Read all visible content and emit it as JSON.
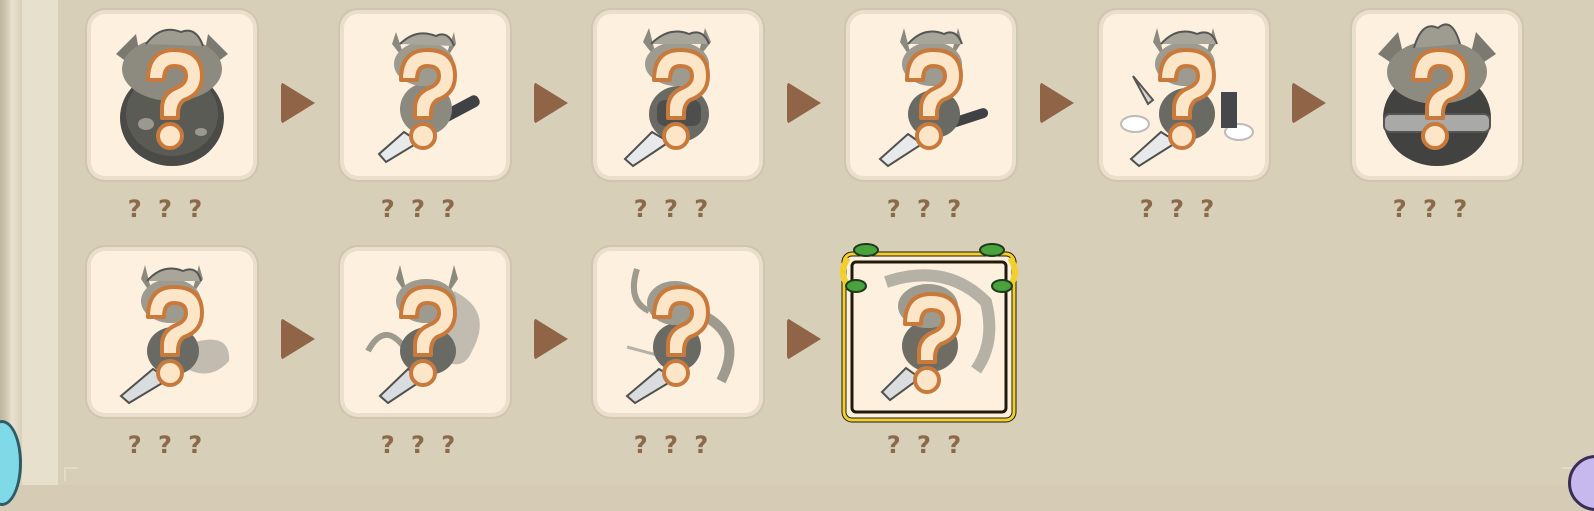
{
  "collection": {
    "row1": [
      {
        "label": "? ? ?",
        "icon": "egg-silhouette-icon"
      },
      {
        "label": "? ? ?",
        "icon": "cat-knight-sword-icon"
      },
      {
        "label": "? ? ?",
        "icon": "cat-knight-armored-icon"
      },
      {
        "label": "? ? ?",
        "icon": "cat-knight-leaping-icon"
      },
      {
        "label": "? ? ?",
        "icon": "cat-knight-clouds-icon"
      },
      {
        "label": "? ? ?",
        "icon": "egg-armored-silhouette-icon"
      }
    ],
    "row2": [
      {
        "label": "? ? ?",
        "icon": "cat-knight-smoke-icon"
      },
      {
        "label": "? ? ?",
        "icon": "cat-knight-wind-icon"
      },
      {
        "label": "? ? ?",
        "icon": "cat-knight-dash-icon"
      },
      {
        "label": "? ? ?",
        "icon": "cat-knight-final-icon"
      }
    ],
    "unknown_mark": "?"
  },
  "colors": {
    "card_bg": "#fef0df",
    "arrow": "#8f6447",
    "label": "#8b6a4c",
    "question_fill": "#fde6c7",
    "question_stroke": "#c87a3d",
    "final_frame_gold": "#f2cf2a"
  }
}
